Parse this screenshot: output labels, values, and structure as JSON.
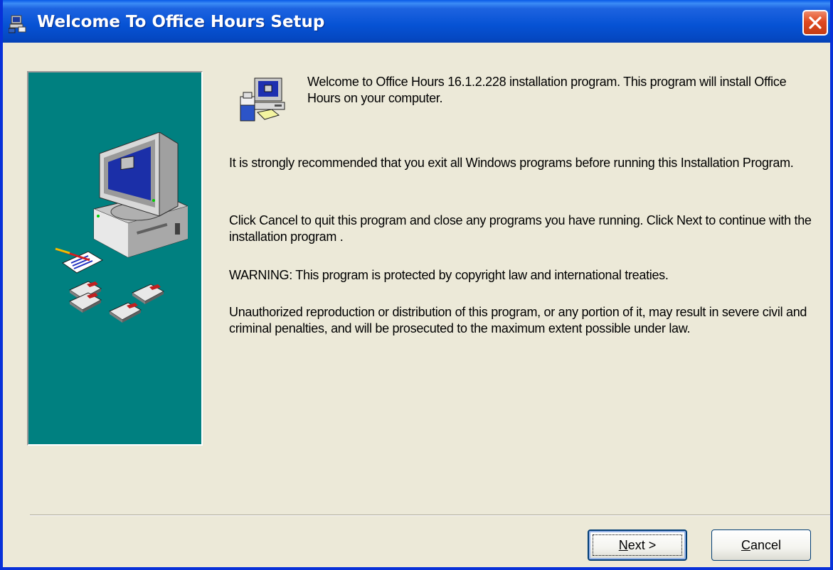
{
  "window": {
    "title": "Welcome To Office Hours Setup"
  },
  "icons": {
    "title_icon": "setup-computer-icon",
    "close": "close-icon",
    "setup_icon": "setup-computer-icon",
    "side_art": "computer-with-disks-illustration"
  },
  "content": {
    "intro": "Welcome to Office Hours 16.1.2.228 installation program. This program will install Office Hours on your computer.",
    "recommendation": "It is strongly recommended that you exit all Windows programs before running this Installation Program.",
    "instructions": "Click Cancel to quit this program and close any programs you have running.  Click Next to continue with the installation program .",
    "warning": "WARNING: This program is protected by copyright law and international treaties.",
    "legal": "Unauthorized reproduction or distribution of this program, or any portion of it, may result in severe civil and criminal penalties, and will be prosecuted to the maximum extent possible under law."
  },
  "buttons": {
    "next_label": "Next >",
    "next_accel": "N",
    "next_rest": "ext >",
    "cancel_label": "Cancel",
    "cancel_accel": "C",
    "cancel_rest": "ancel"
  },
  "colors": {
    "titlebar": "#0652d4",
    "side_panel": "#008080",
    "dialog_bg": "#ece9d8",
    "close_button": "#e04a20"
  }
}
